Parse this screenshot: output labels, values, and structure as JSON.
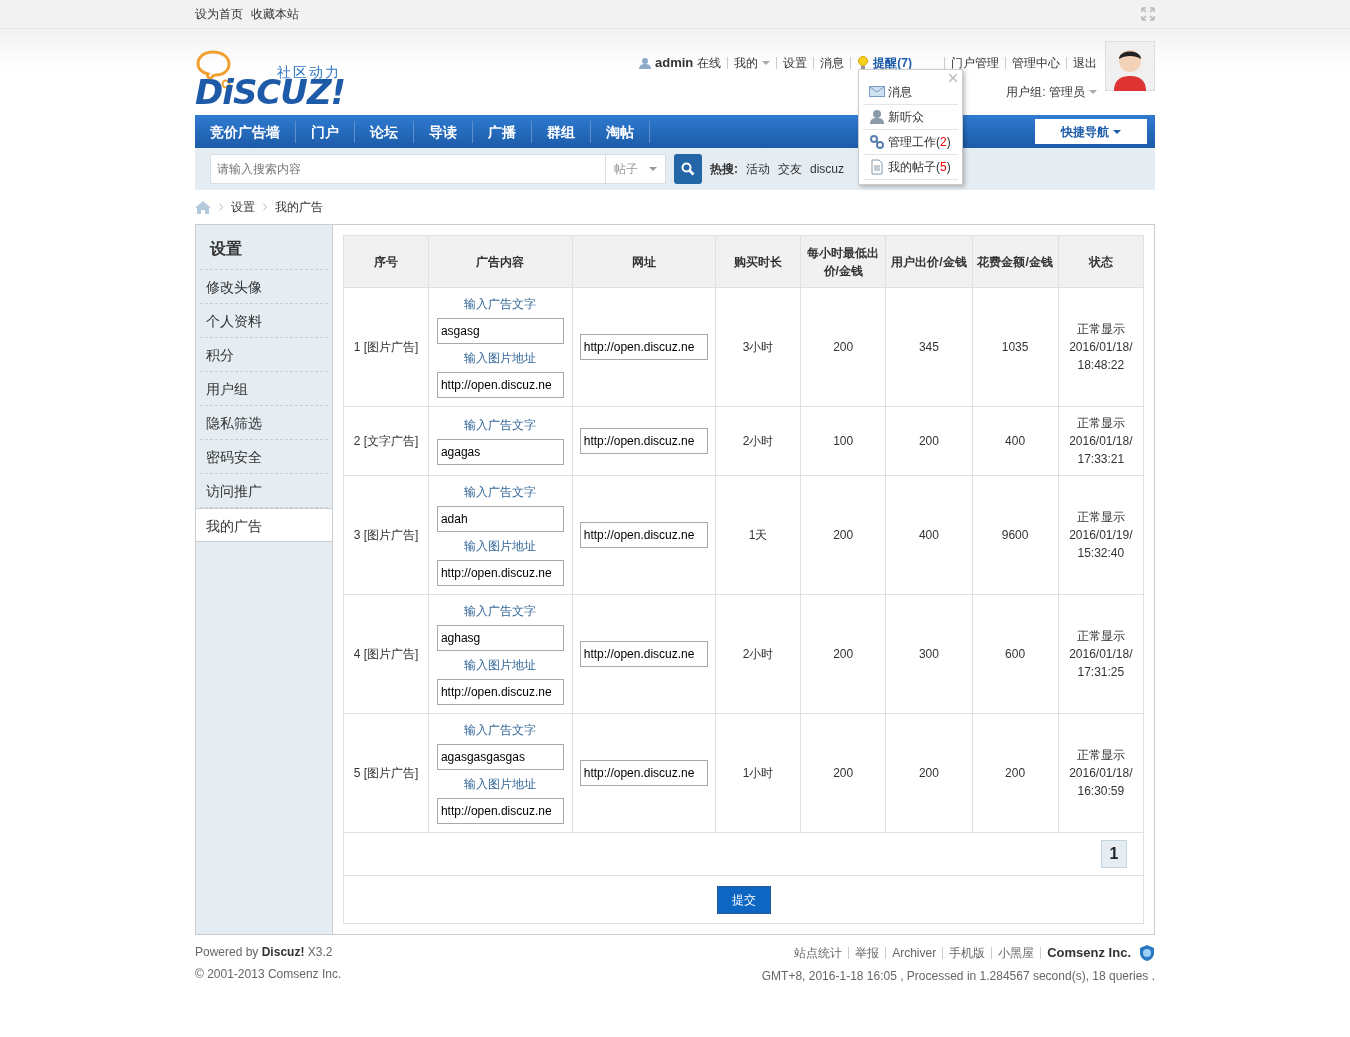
{
  "topbar": {
    "links": [
      "设为首页",
      "收藏本站"
    ]
  },
  "logo": {
    "tagline": "社区动力",
    "name": "DiSCUZ!"
  },
  "user": {
    "name": "admin",
    "status": "在线",
    "menu": [
      {
        "label": "我的",
        "caret": true
      },
      {
        "label": "设置",
        "caret": false
      },
      {
        "label": "消息",
        "caret": false
      }
    ],
    "notice": "提醒(7)",
    "links": [
      "门户管理",
      "管理中心",
      "退出"
    ],
    "group": "用户组: 管理员"
  },
  "popup": {
    "items": [
      {
        "kind": "mail",
        "text": "消息"
      },
      {
        "kind": "user",
        "text": "新听众"
      },
      {
        "kind": "link",
        "text": "管理工作(",
        "count": "2",
        "text_end": ")"
      },
      {
        "kind": "doc",
        "text": "我的帖子(",
        "count": "5",
        "text_end": ")"
      }
    ]
  },
  "nav": {
    "items": [
      "竞价广告墙",
      "门户",
      "论坛",
      "导读",
      "广播",
      "群组",
      "淘帖"
    ],
    "quick": "快捷导航"
  },
  "search": {
    "placeholder": "请输入搜索内容",
    "type": "帖子",
    "hot_label": "热搜:",
    "hot": [
      "活动",
      "交友",
      "discuz"
    ]
  },
  "breadcrumb": [
    "设置",
    "我的广告"
  ],
  "sidebar": {
    "title": "设置",
    "items": [
      {
        "label": "修改头像",
        "selected": false
      },
      {
        "label": "个人资料",
        "selected": false
      },
      {
        "label": "积分",
        "selected": false
      },
      {
        "label": "用户组",
        "selected": false
      },
      {
        "label": "隐私筛选",
        "selected": false
      },
      {
        "label": "密码安全",
        "selected": false
      },
      {
        "label": "访问推广",
        "selected": false
      },
      {
        "label": "我的广告",
        "selected": true
      }
    ]
  },
  "table": {
    "columns": [
      "序号",
      "广告内容",
      "网址",
      "购买时长",
      "每小时最低出价/金钱",
      "用户出价/金钱",
      "花费金额/金钱",
      "状态"
    ],
    "rows": [
      {
        "index": "1 [图片广告]",
        "kind": "image",
        "text_label": "输入广告文字",
        "text": "asgasg",
        "image_label": "输入图片地址",
        "image_url": "http://open.discuz.ne",
        "url": "http://open.discuz.ne",
        "duration": "3小时",
        "min_bid": "200",
        "bid": "345",
        "spent": "1035",
        "status": "正常显示",
        "time": "2016/01/18/18:48:22"
      },
      {
        "index": "2 [文字广告]",
        "kind": "text",
        "text_label": "输入广告文字",
        "text": "agagas",
        "url": "http://open.discuz.ne",
        "duration": "2小时",
        "min_bid": "100",
        "bid": "200",
        "spent": "400",
        "status": "正常显示",
        "time": "2016/01/18/17:33:21"
      },
      {
        "index": "3 [图片广告]",
        "kind": "image",
        "text_label": "输入广告文字",
        "text": "adah",
        "image_label": "输入图片地址",
        "image_url": "http://open.discuz.ne",
        "url": "http://open.discuz.ne",
        "duration": "1天",
        "min_bid": "200",
        "bid": "400",
        "spent": "9600",
        "status": "正常显示",
        "time": "2016/01/19/15:32:40"
      },
      {
        "index": "4 [图片广告]",
        "kind": "image",
        "text_label": "输入广告文字",
        "text": "aghasg",
        "image_label": "输入图片地址",
        "image_url": "http://open.discuz.ne",
        "url": "http://open.discuz.ne",
        "duration": "2小时",
        "min_bid": "200",
        "bid": "300",
        "spent": "600",
        "status": "正常显示",
        "time": "2016/01/18/17:31:25"
      },
      {
        "index": "5 [图片广告]",
        "kind": "image",
        "text_label": "输入广告文字",
        "text": "agasgasgasgas",
        "image_label": "输入图片地址",
        "image_url": "http://open.discuz.ne",
        "url": "http://open.discuz.ne",
        "duration": "1小时",
        "min_bid": "200",
        "bid": "200",
        "spent": "200",
        "status": "正常显示",
        "time": "2016/01/18/16:30:59"
      }
    ],
    "pages": [
      {
        "label": "1",
        "selected": true
      }
    ],
    "submit": "提交"
  },
  "footer": {
    "powered_prefix": "Powered by ",
    "powered_brand": "Discuz!",
    "version": " X3.2",
    "copyright": "© 2001-2013 Comsenz Inc.",
    "links": [
      "站点统计",
      "举报",
      "Archiver",
      "手机版",
      "小黑屋"
    ],
    "company": "Comsenz Inc.",
    "info": "GMT+8, 2016-1-18 16:05 , Processed in 1.284567 second(s), 18 queries ."
  }
}
